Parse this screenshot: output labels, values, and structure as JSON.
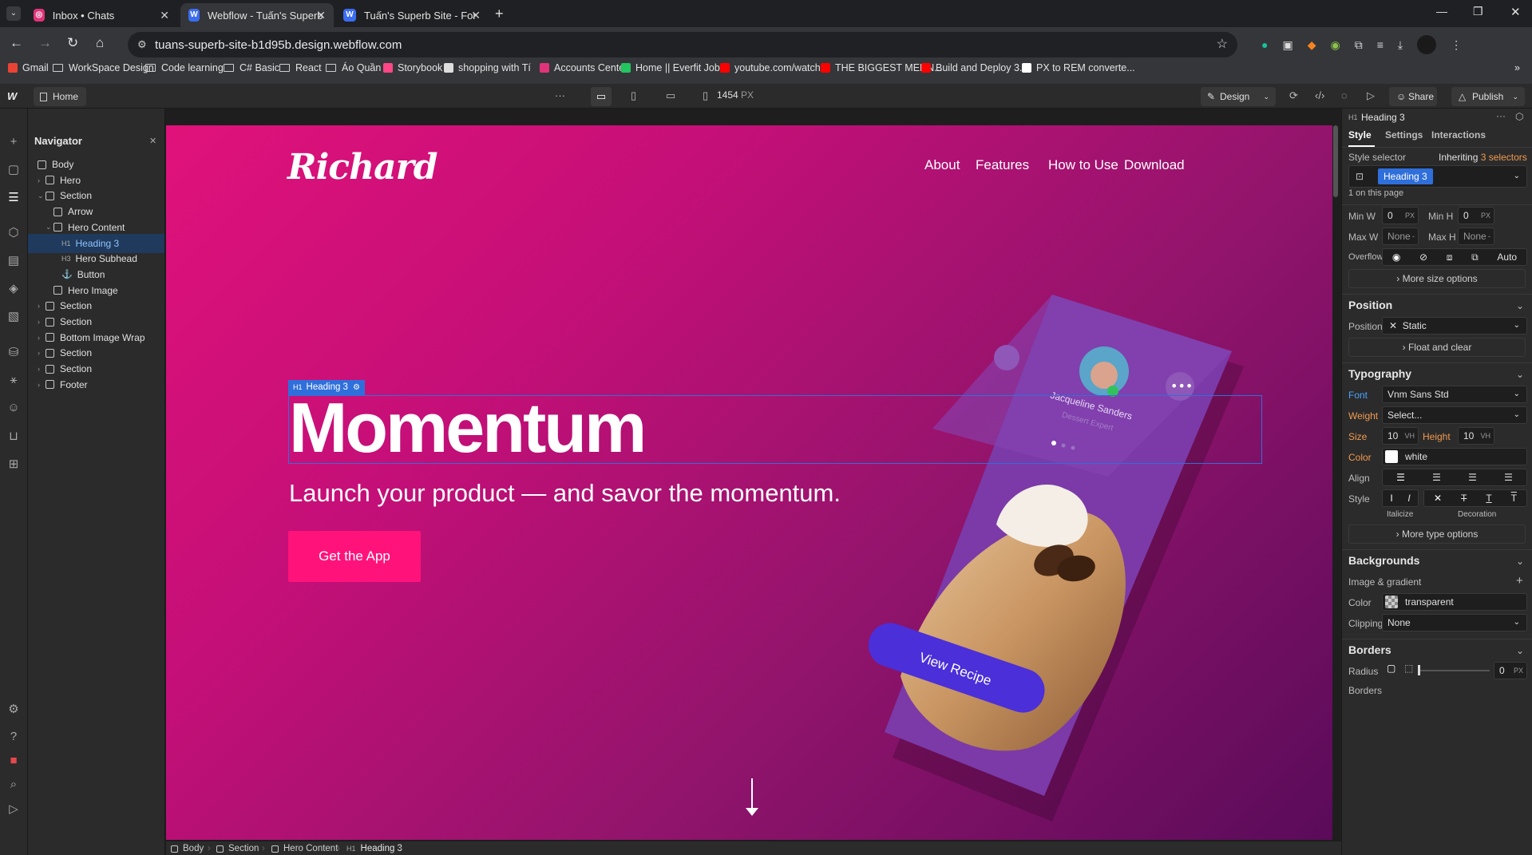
{
  "browser": {
    "tabs": [
      {
        "title": "Inbox • Chats",
        "icon_color": "#e0337a"
      },
      {
        "title": "Webflow - Tuấn's Superb Site",
        "icon_color": "#3b6df0"
      },
      {
        "title": "Tuấn's Superb Site - Fonts - We",
        "icon_color": "#3b6df0"
      }
    ],
    "url": "tuans-superb-site-b1d95b.design.webflow.com",
    "bookmarks": [
      {
        "label": "Gmail",
        "icon": "gmail-icon"
      },
      {
        "label": "WorkSpace Design",
        "icon": "folder-icon"
      },
      {
        "label": "Code learning",
        "icon": "folder-icon"
      },
      {
        "label": "C# Basic",
        "icon": "folder-icon"
      },
      {
        "label": "React",
        "icon": "folder-icon"
      },
      {
        "label": "Áo Quần",
        "icon": "folder-icon"
      },
      {
        "label": "Storybook",
        "icon": "storybook-icon"
      },
      {
        "label": "shopping with Tí",
        "icon": "github-icon"
      },
      {
        "label": "Accounts Center",
        "icon": "instagram-icon"
      },
      {
        "label": "Home || Everfit Job...",
        "icon": "everfit-icon"
      },
      {
        "label": "youtube.com/watch...",
        "icon": "youtube-icon"
      },
      {
        "label": "THE BIGGEST MERN...",
        "icon": "youtube-icon"
      },
      {
        "label": "Build and Deploy 3...",
        "icon": "youtube-icon"
      },
      {
        "label": "PX to REM converte...",
        "icon": "converter-icon"
      }
    ]
  },
  "wf": {
    "home_label": "Home",
    "width_value": "1454",
    "width_unit": "PX",
    "design_label": "Design",
    "share_label": "Share",
    "publish_label": "Publish"
  },
  "navigator": {
    "title": "Navigator",
    "nodes": [
      {
        "label": "Body"
      },
      {
        "label": "Hero"
      },
      {
        "label": "Section"
      },
      {
        "label": "Arrow"
      },
      {
        "label": "Hero Content"
      },
      {
        "label": "Heading 3",
        "tag": "H1"
      },
      {
        "label": "Hero Subhead",
        "tag": "H3"
      },
      {
        "label": "Button"
      },
      {
        "label": "Hero Image"
      },
      {
        "label": "Section"
      },
      {
        "label": "Section"
      },
      {
        "label": "Bottom Image Wrap"
      },
      {
        "label": "Section"
      },
      {
        "label": "Section"
      },
      {
        "label": "Footer"
      }
    ]
  },
  "site": {
    "logo": "Richard",
    "nav": [
      "About",
      "Features",
      "How to Use",
      "Download"
    ],
    "heading": "Momentum",
    "selected_tag": "H1",
    "selected_label": "Heading 3",
    "subhead": "Launch your product — and savor the momentum.",
    "cta": "Get the App",
    "phone": {
      "name": "Jacqueline Sanders",
      "role": "Dessert Expert",
      "button": "View Recipe"
    }
  },
  "panel": {
    "element_tag": "H1",
    "element_name": "Heading 3",
    "tabs": [
      "Style",
      "Settings",
      "Interactions"
    ],
    "style_selector_label": "Style selector",
    "inheriting": "Inheriting",
    "inheriting_count": "3 selectors",
    "selector_chip": "Heading 3",
    "on_page": "1 on this page",
    "min_w_label": "Min W",
    "min_w": "0",
    "min_w_unit": "PX",
    "min_h_label": "Min H",
    "min_h": "0",
    "min_h_unit": "PX",
    "max_w_label": "Max W",
    "max_w": "None",
    "max_w_unit": "-",
    "max_h_label": "Max H",
    "max_h": "None",
    "max_h_unit": "-",
    "overflow_label": "Overflow",
    "overflow_auto": "Auto",
    "more_size": "More size options",
    "position_title": "Position",
    "position_label": "Position",
    "position_value": "Static",
    "float_clear": "Float and clear",
    "typography_title": "Typography",
    "font_label": "Font",
    "font_value": "Vnm Sans Std",
    "weight_label": "Weight",
    "weight_value": "Select...",
    "size_label": "Size",
    "size_value": "10",
    "size_unit": "VH",
    "height_label": "Height",
    "height_value": "10",
    "height_unit": "VH",
    "color_label": "Color",
    "color_value": "white",
    "align_label": "Align",
    "style_label": "Style",
    "italicize": "Italicize",
    "decoration": "Decoration",
    "more_type": "More type options",
    "backgrounds_title": "Backgrounds",
    "image_gradient": "Image & gradient",
    "bg_color_label": "Color",
    "bg_color_value": "transparent",
    "clipping_label": "Clipping",
    "clipping_value": "None",
    "borders_title": "Borders",
    "radius_label": "Radius",
    "radius_value": "0",
    "radius_unit": "PX",
    "borders_label": "Borders"
  },
  "breadcrumb": [
    "Body",
    "Section",
    "Hero Content",
    "Heading 3"
  ],
  "breadcrumb_tag": "H1",
  "colors": {
    "accent": "#2f6fdb",
    "cta": "#ff137b",
    "phone": "#7b3aa8",
    "view_recipe": "#4b2fd9"
  }
}
